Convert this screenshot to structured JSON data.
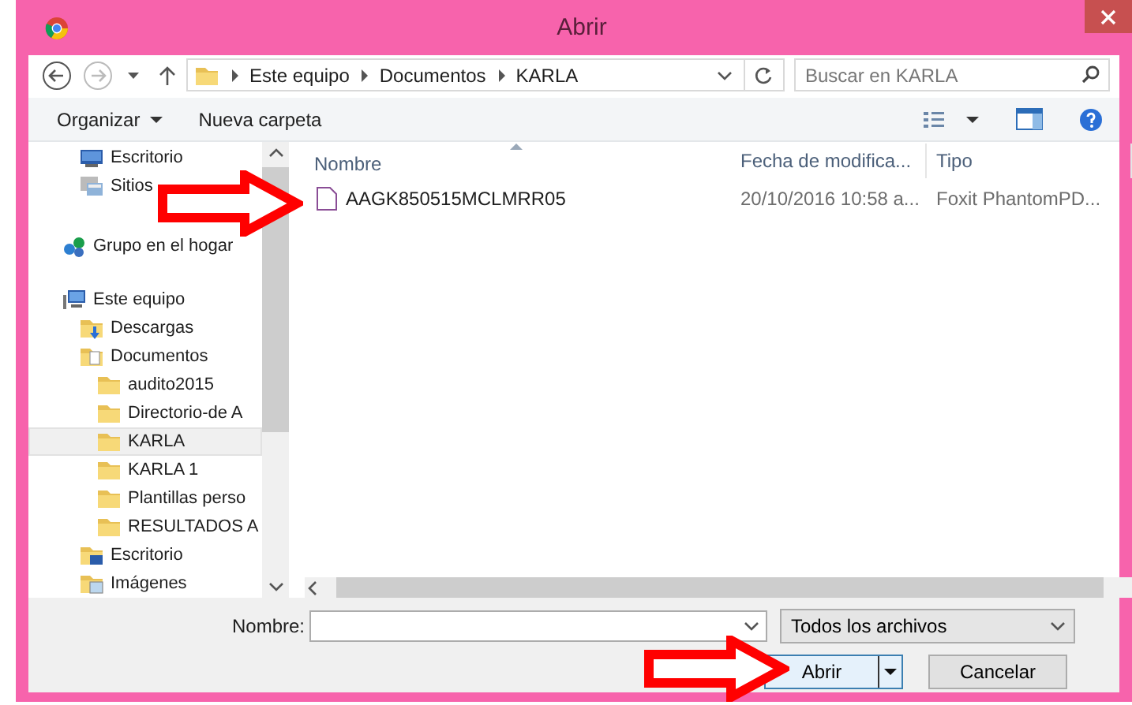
{
  "window": {
    "title": "Abrir"
  },
  "address": {
    "path": [
      "Este equipo",
      "Documentos",
      "KARLA"
    ]
  },
  "search": {
    "placeholder": "Buscar en KARLA"
  },
  "toolbar": {
    "organize": "Organizar",
    "new_folder": "Nueva carpeta"
  },
  "sidebar": {
    "items": [
      {
        "kind": "group",
        "children": [
          {
            "label": "Escritorio",
            "kind": "desktop",
            "selected": false
          },
          {
            "label": "Sitios",
            "kind": "recent",
            "selected": false
          }
        ]
      },
      {
        "label": "Grupo en el hogar",
        "kind": "homegroup",
        "selected": false
      },
      {
        "label": "Este equipo",
        "kind": "computer",
        "selected": false,
        "children": [
          {
            "label": "Descargas",
            "kind": "downloads",
            "selected": false
          },
          {
            "label": "Documentos",
            "kind": "documents",
            "selected": false,
            "children": [
              {
                "label": "audito2015",
                "kind": "folder",
                "selected": false
              },
              {
                "label": "Directorio-de A",
                "kind": "folder",
                "selected": false
              },
              {
                "label": "KARLA",
                "kind": "folder",
                "selected": true
              },
              {
                "label": "KARLA 1",
                "kind": "folder",
                "selected": false
              },
              {
                "label": "Plantillas perso",
                "kind": "folder",
                "selected": false
              },
              {
                "label": "RESULTADOS A",
                "kind": "folder",
                "selected": false
              }
            ]
          },
          {
            "label": "Escritorio",
            "kind": "desktopfolder",
            "selected": false
          },
          {
            "label": "Imágenes",
            "kind": "pictures",
            "selected": false
          }
        ]
      }
    ]
  },
  "files": {
    "columns": [
      "Nombre",
      "Fecha de modifica...",
      "Tipo"
    ],
    "rows": [
      {
        "name": "AAGK850515MCLMRR05",
        "date": "20/10/2016 10:58 a...",
        "type": "Foxit PhantomPD..."
      }
    ]
  },
  "footer": {
    "name_label": "Nombre:",
    "filter": "Todos los archivos",
    "open_button": "Abrir",
    "cancel_button": "Cancelar"
  }
}
